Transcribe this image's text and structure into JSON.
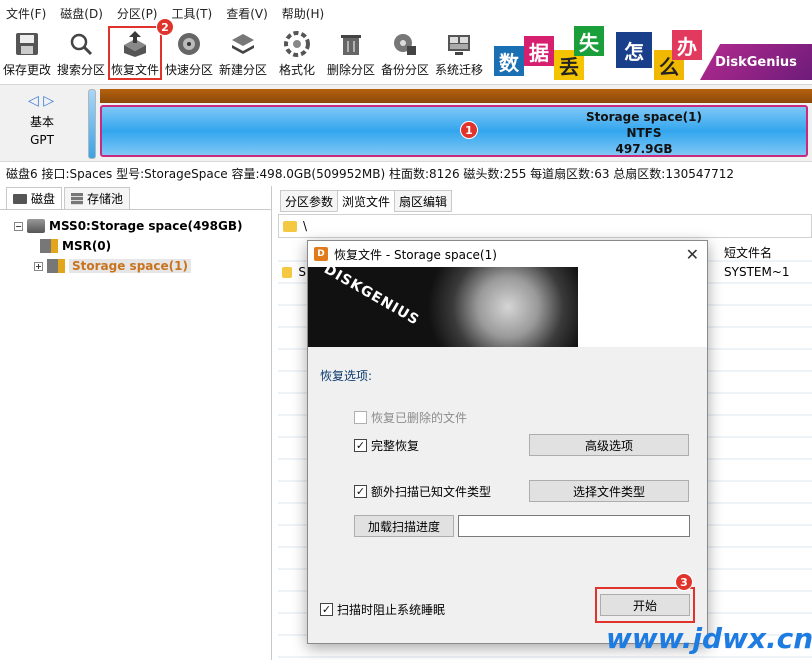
{
  "menu": [
    "文件(F)",
    "磁盘(D)",
    "分区(P)",
    "工具(T)",
    "查看(V)",
    "帮助(H)"
  ],
  "toolbar": [
    {
      "label": "保存更改",
      "icon": "save-icon"
    },
    {
      "label": "搜索分区",
      "icon": "magnifier-icon"
    },
    {
      "label": "恢复文件",
      "icon": "recover-box-icon",
      "highlighted": true
    },
    {
      "label": "快速分区",
      "icon": "disk-quick-icon"
    },
    {
      "label": "新建分区",
      "icon": "layers-icon"
    },
    {
      "label": "格式化",
      "icon": "format-icon"
    },
    {
      "label": "删除分区",
      "icon": "trash-icon"
    },
    {
      "label": "备份分区",
      "icon": "backup-icon"
    },
    {
      "label": "系统迁移",
      "icon": "migrate-icon"
    }
  ],
  "banner": {
    "tiles": [
      "数",
      "据",
      "丢",
      "失",
      "怎",
      "么",
      "办"
    ],
    "brand": "DiskGenius"
  },
  "badges": {
    "b1": "1",
    "b2": "2",
    "b3": "3"
  },
  "disk": {
    "kind_line1": "基本",
    "kind_line2": "GPT",
    "partition_name": "Storage space(1)",
    "partition_fs": "NTFS",
    "partition_size": "497.9GB"
  },
  "info_line": "磁盘6 接口:Spaces  型号:StorageSpace  容量:498.0GB(509952MB)  柱面数:8126  磁头数:255  每道扇区数:63  总扇区数:130547712",
  "left_tabs": [
    "磁盘",
    "存储池"
  ],
  "tree": {
    "root": "MSS0:Storage space(498GB)",
    "child1": "MSR(0)",
    "child2": "Storage space(1)"
  },
  "right_tabs": [
    "分区参数",
    "浏览文件",
    "扇区编辑"
  ],
  "path": "\\",
  "file_list": {
    "column_short_name": "短文件名",
    "row1_prefix": "S",
    "row1_short_name": "SYSTEM~1"
  },
  "dialog": {
    "title": "恢复文件 - Storage space(1)",
    "header_logo": "DISKGENIUS",
    "section": "恢复选项:",
    "opt_recover_deleted": {
      "label": "恢复已删除的文件",
      "checked": false,
      "disabled": true
    },
    "opt_full_recover": {
      "label": "完整恢复",
      "checked": true
    },
    "btn_advanced": "高级选项",
    "opt_extra_scan": {
      "label": "额外扫描已知文件类型",
      "checked": true
    },
    "btn_choose_types": "选择文件类型",
    "btn_load_progress": "加载扫描进度",
    "progress_path": "",
    "opt_prevent_sleep": {
      "label": "扫描时阻止系统睡眠",
      "checked": true
    },
    "btn_start": "开始"
  },
  "watermark": "www.jdwx.cn"
}
